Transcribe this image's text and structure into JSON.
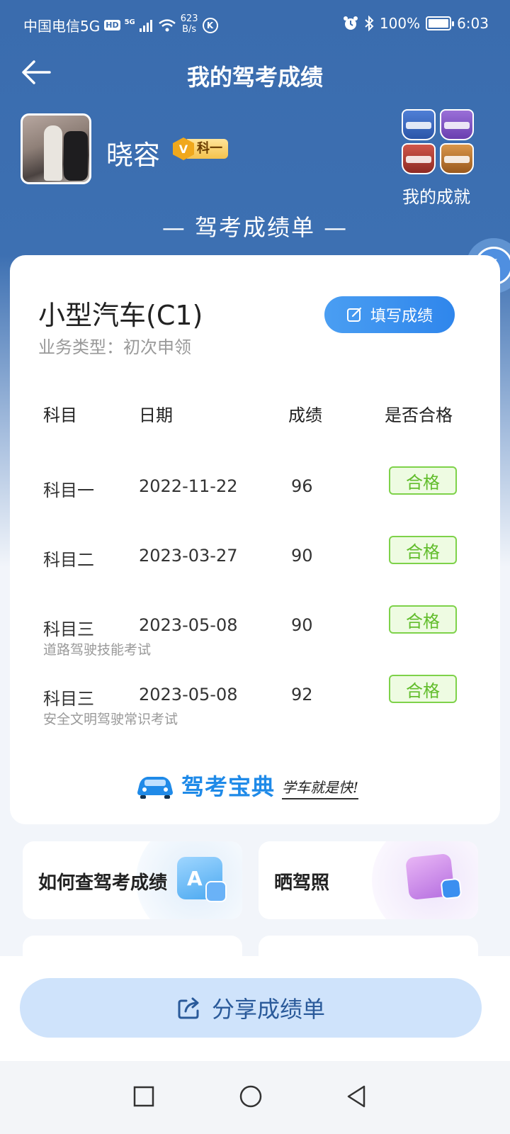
{
  "status_bar": {
    "carrier": "中国电信5G",
    "hd": "HD",
    "net": "5G",
    "speed_value": "623",
    "speed_unit": "B/s",
    "k_badge": "K",
    "battery": "100%",
    "time": "6:03"
  },
  "header": {
    "title": "我的驾考成绩"
  },
  "profile": {
    "name": "晓容",
    "level_v": "V",
    "level_label": "科一",
    "achievements_label": "我的成就"
  },
  "section_title": "— 驾考成绩单 —",
  "card": {
    "car_type": "小型汽车(C1)",
    "business_type": "业务类型：初次申领",
    "fill_button": "填写成绩",
    "columns": [
      "科目",
      "日期",
      "成绩",
      "是否合格"
    ],
    "rows": [
      {
        "subject": "科目一",
        "date": "2022-11-22",
        "score": "96",
        "result": "合格",
        "note": ""
      },
      {
        "subject": "科目二",
        "date": "2023-03-27",
        "score": "90",
        "result": "合格",
        "note": ""
      },
      {
        "subject": "科目三",
        "date": "2023-05-08",
        "score": "90",
        "result": "合格",
        "note": "道路驾驶技能考试"
      },
      {
        "subject": "科目三",
        "date": "2023-05-08",
        "score": "92",
        "result": "合格",
        "note": "安全文明驾驶常识考试"
      }
    ],
    "brand_name": "驾考宝典",
    "brand_slogan": "学车就是快!"
  },
  "tiles": [
    {
      "label": "如何查驾考成绩"
    },
    {
      "label": "晒驾照"
    }
  ],
  "share_button": "分享成绩单",
  "colors": {
    "primary_blue": "#3a6cae",
    "button_blue": "#2f86ec",
    "pass_green": "#62bd2c"
  }
}
